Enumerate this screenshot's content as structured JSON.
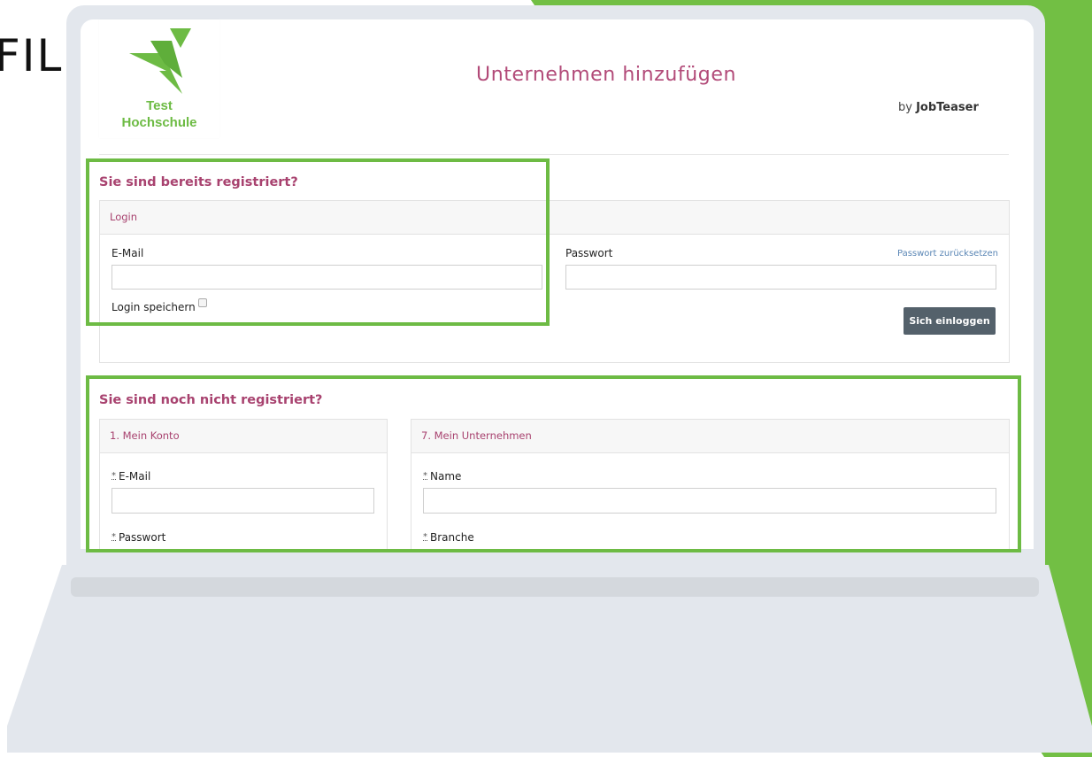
{
  "background": {
    "partial_text": "FIL",
    "accent_color": "#72bf44"
  },
  "logo": {
    "line1": "Test",
    "line2": "Hochschule",
    "color": "#6dbb44"
  },
  "header": {
    "title": "Unternehmen hinzufügen",
    "by_prefix": "by",
    "by_brand": "JobTeaser"
  },
  "login_section": {
    "title": "Sie sind bereits registriert?",
    "panel_title": "Login",
    "email_label": "E-Mail",
    "email_value": "",
    "password_label": "Passwort",
    "password_value": "",
    "reset_link": "Passwort zurücksetzen",
    "remember_label": "Login speichern",
    "remember_checked": false,
    "submit_label": "Sich einloggen"
  },
  "register_section": {
    "title": "Sie sind noch nicht registriert?",
    "account_panel": {
      "title": "1. Mein Konto",
      "required_marker": "*",
      "email_label": "E-Mail",
      "email_value": "",
      "password_label": "Passwort"
    },
    "company_panel": {
      "title": "7. Mein Unternehmen",
      "required_marker": "*",
      "name_label": "Name",
      "name_value": "",
      "industry_label": "Branche"
    }
  },
  "colors": {
    "title": "#b24a78",
    "accent_green": "#6dbb44",
    "button": "#54616b",
    "link": "#5a86b5"
  }
}
